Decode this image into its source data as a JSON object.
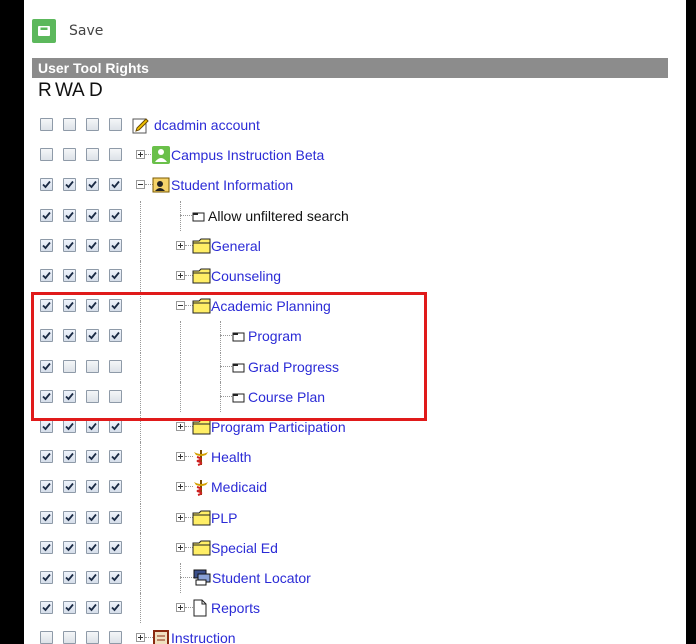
{
  "toolbar": {
    "save_label": "Save"
  },
  "section": {
    "title": "User Tool Rights"
  },
  "columns": [
    "R",
    "W",
    "A",
    "D"
  ],
  "tree": [
    {
      "label": "dcadmin account",
      "level": 0,
      "checks": [
        false,
        false,
        false,
        false
      ],
      "expander": "none",
      "icon": "edit-account-icon"
    },
    {
      "label": "Campus Instruction Beta",
      "level": 1,
      "checks": [
        false,
        false,
        false,
        false
      ],
      "expander": "plus",
      "icon": "person-icon"
    },
    {
      "label": "Student Information",
      "level": 1,
      "checks": [
        true,
        true,
        true,
        true
      ],
      "expander": "minus",
      "icon": "student-info-icon"
    },
    {
      "label": "Allow unfiltered search",
      "level": 2,
      "checks": [
        true,
        true,
        true,
        true
      ],
      "expander": "none",
      "icon": "tool-icon"
    },
    {
      "label": "General",
      "level": 2,
      "checks": [
        true,
        true,
        true,
        true
      ],
      "expander": "plus",
      "icon": "folder-icon"
    },
    {
      "label": "Counseling",
      "level": 2,
      "checks": [
        true,
        true,
        true,
        true
      ],
      "expander": "plus",
      "icon": "folder-icon"
    },
    {
      "label": "Academic Planning",
      "level": 2,
      "checks": [
        true,
        true,
        true,
        true
      ],
      "expander": "minus",
      "icon": "folder-icon"
    },
    {
      "label": "Program",
      "level": 3,
      "checks": [
        true,
        true,
        true,
        true
      ],
      "expander": "none",
      "icon": "tool-icon"
    },
    {
      "label": "Grad Progress",
      "level": 3,
      "checks": [
        true,
        false,
        false,
        false
      ],
      "expander": "none",
      "icon": "tool-icon"
    },
    {
      "label": "Course Plan",
      "level": 3,
      "checks": [
        true,
        true,
        false,
        false
      ],
      "expander": "none",
      "icon": "tool-icon"
    },
    {
      "label": "Program Participation",
      "level": 2,
      "checks": [
        true,
        true,
        true,
        true
      ],
      "expander": "plus",
      "icon": "folder-icon"
    },
    {
      "label": "Health",
      "level": 2,
      "checks": [
        true,
        true,
        true,
        true
      ],
      "expander": "plus",
      "icon": "caduceus-icon"
    },
    {
      "label": "Medicaid",
      "level": 2,
      "checks": [
        true,
        true,
        true,
        true
      ],
      "expander": "plus",
      "icon": "caduceus-icon"
    },
    {
      "label": "PLP",
      "level": 2,
      "checks": [
        true,
        true,
        true,
        true
      ],
      "expander": "plus",
      "icon": "folder-icon"
    },
    {
      "label": "Special Ed",
      "level": 2,
      "checks": [
        true,
        true,
        true,
        true
      ],
      "expander": "plus",
      "icon": "folder-icon"
    },
    {
      "label": "Student Locator",
      "level": 2,
      "checks": [
        true,
        true,
        true,
        true
      ],
      "expander": "none",
      "icon": "locator-icon"
    },
    {
      "label": "Reports",
      "level": 2,
      "checks": [
        true,
        true,
        true,
        true
      ],
      "expander": "plus",
      "icon": "report-icon"
    },
    {
      "label": "Instruction",
      "level": 1,
      "checks": [
        false,
        false,
        false,
        false
      ],
      "expander": "plus",
      "icon": "instruction-icon"
    }
  ],
  "colors": {
    "link": "#2b2bd6",
    "header_bg": "#8c8c8c",
    "highlight": "#e01a1a",
    "save_icon": "#5cb85c"
  }
}
